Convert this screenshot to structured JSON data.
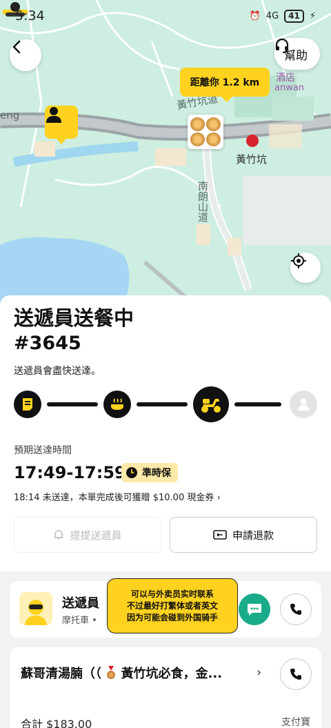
{
  "status_bar": {
    "time": "5:34",
    "network": "4G",
    "battery": "41"
  },
  "map": {
    "labels": {
      "road_main": "黃竹坑道",
      "road_side": "南朗山道",
      "station": "黃竹坑",
      "hotel": "酒店",
      "hotel_en": "anwan",
      "edge_left": "eng"
    },
    "distance": "距離你 1.2 km",
    "help": "幫助"
  },
  "order": {
    "status": "送遞員送餐中",
    "number": "#3645",
    "description": "送遞員會盡快送達。",
    "eta_label": "預期送達時間",
    "eta": "17:49-17:59",
    "on_time_badge": "準時保",
    "coupon_note": "18:14 未送達，本單完成後可獲贈 $10.00 現金券 ›",
    "remind_button": "提提送遞員",
    "refund_button": "申請退款",
    "progress_steps": [
      "order-icon",
      "cooking-icon",
      "scooter-icon",
      "user-icon"
    ]
  },
  "rider": {
    "title": "送遞員",
    "vehicle": "摩托車 •",
    "tip_lines": [
      "可以与外卖员实时联系",
      "不过最好打繁体或者英文",
      "因为可能会碰到外国骑手"
    ]
  },
  "store": {
    "name_prefix": "蘇哥清湯腩（（",
    "name_suffix": "黃竹坑必食，金...",
    "total": "合計 $183.00",
    "payment": "支付寶"
  },
  "colors": {
    "brand_yellow": "#ffd21f",
    "chat_green": "#1aab8a",
    "map_green": "#cdeee0"
  }
}
